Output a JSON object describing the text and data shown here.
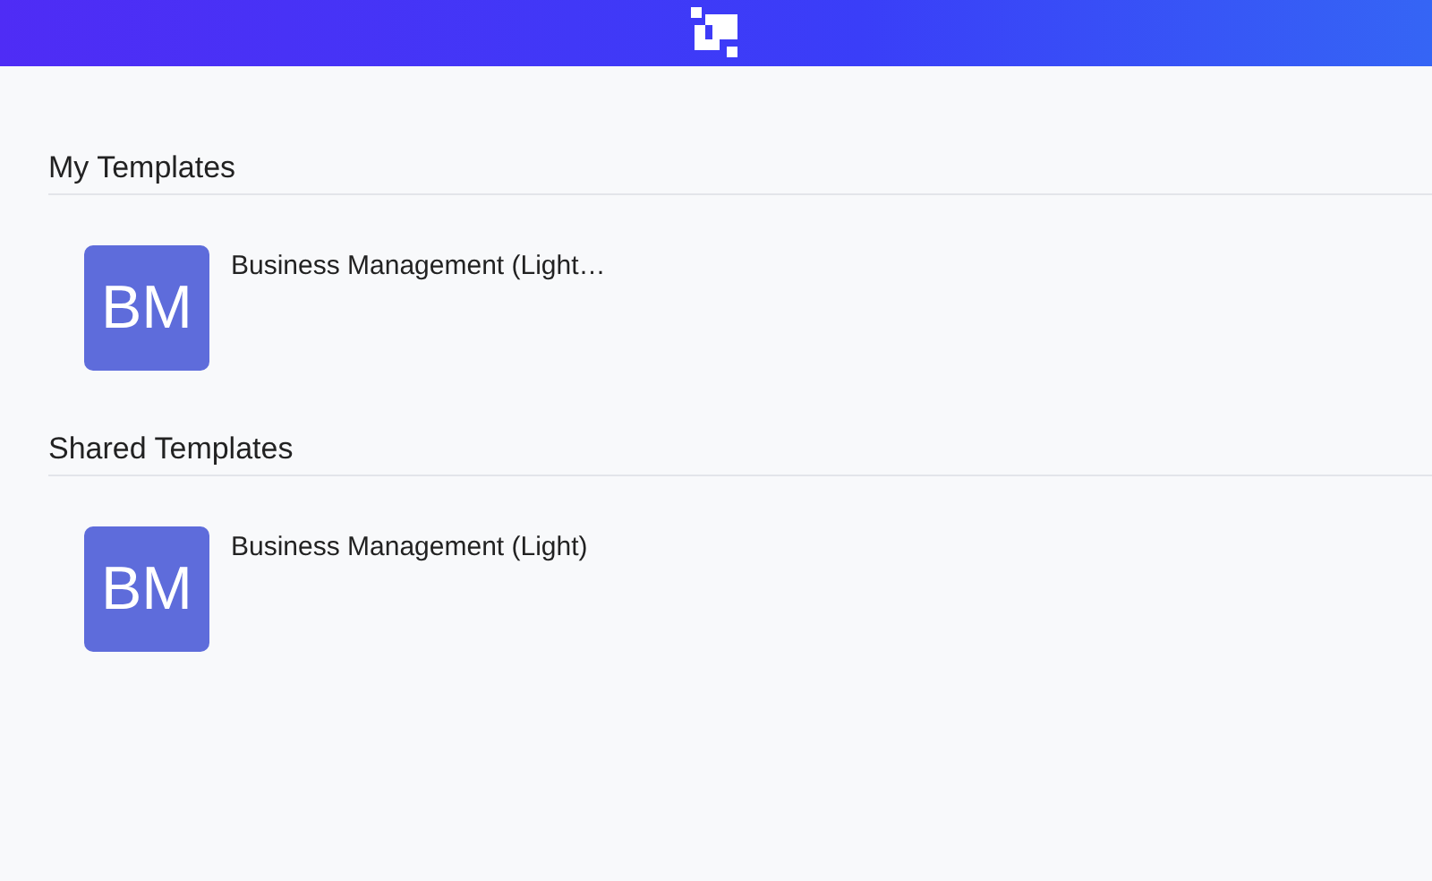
{
  "sections": [
    {
      "title": "My Templates",
      "templates": [
        {
          "initials": "BM",
          "name": "Business Management (Light…"
        }
      ]
    },
    {
      "title": "Shared Templates",
      "templates": [
        {
          "initials": "BM",
          "name": "Business Management (Light)"
        }
      ]
    }
  ]
}
